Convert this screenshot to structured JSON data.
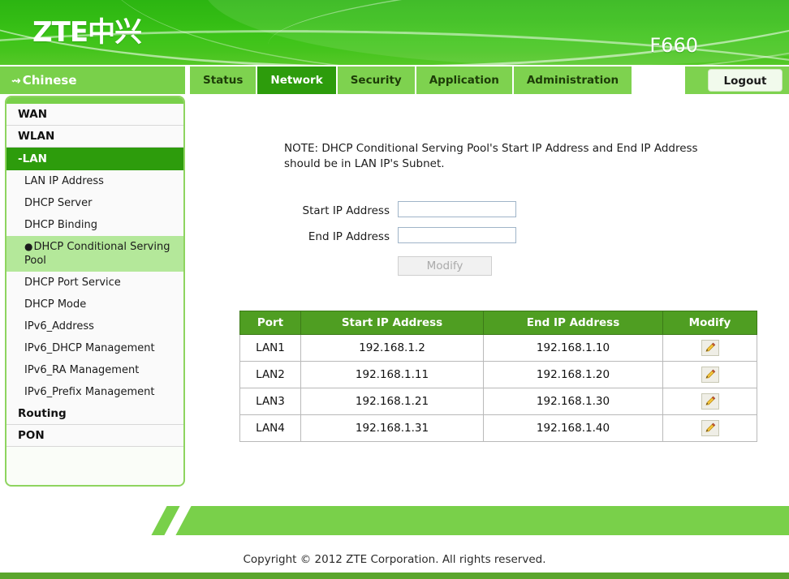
{
  "header": {
    "logo_text": "ZTE中兴",
    "model": "F660",
    "brand_green": "#3cc318"
  },
  "nav": {
    "language_button": {
      "label": "Chinese",
      "icon": "arrow-right-icon"
    },
    "tabs": [
      {
        "label": "Status",
        "active": false
      },
      {
        "label": "Network",
        "active": true
      },
      {
        "label": "Security",
        "active": false
      },
      {
        "label": "Application",
        "active": false
      },
      {
        "label": "Administration",
        "active": false
      }
    ],
    "logout_label": "Logout",
    "active_tab_color": "#2d9c0c",
    "tab_color": "#7ed24f"
  },
  "sidebar": {
    "items": [
      {
        "label": "WAN",
        "type": "group",
        "state": "normal"
      },
      {
        "label": "WLAN",
        "type": "group",
        "state": "normal"
      },
      {
        "label": "-LAN",
        "type": "group",
        "state": "selected"
      },
      {
        "label": "LAN IP Address",
        "type": "item",
        "state": "normal"
      },
      {
        "label": "DHCP Server",
        "type": "item",
        "state": "normal"
      },
      {
        "label": "DHCP Binding",
        "type": "item",
        "state": "normal"
      },
      {
        "label": "DHCP Conditional Serving Pool",
        "type": "item",
        "state": "active",
        "bullet": "●"
      },
      {
        "label": "DHCP Port Service",
        "type": "item",
        "state": "normal"
      },
      {
        "label": "DHCP Mode",
        "type": "item",
        "state": "normal"
      },
      {
        "label": "IPv6_Address",
        "type": "item",
        "state": "normal"
      },
      {
        "label": "IPv6_DHCP Management",
        "type": "item",
        "state": "normal"
      },
      {
        "label": "IPv6_RA Management",
        "type": "item",
        "state": "normal"
      },
      {
        "label": "IPv6_Prefix Management",
        "type": "item",
        "state": "normal"
      },
      {
        "label": "Routing",
        "type": "group",
        "state": "normal"
      },
      {
        "label": "PON",
        "type": "group",
        "state": "normal"
      }
    ]
  },
  "main": {
    "note": "NOTE:  DHCP Conditional Serving Pool's Start IP Address and End IP Address should be in LAN IP's Subnet.",
    "fields": [
      {
        "label": "Start IP Address",
        "value": "",
        "placeholder": ""
      },
      {
        "label": "End IP Address",
        "value": "",
        "placeholder": ""
      }
    ],
    "modify_button": {
      "label": "Modify",
      "disabled": true
    },
    "table": {
      "columns": [
        "Port",
        "Start IP Address",
        "End IP Address",
        "Modify"
      ],
      "rows": [
        {
          "port": "LAN1",
          "start_ip": "192.168.1.2",
          "end_ip": "192.168.1.10",
          "modify_icon": "pencil-icon"
        },
        {
          "port": "LAN2",
          "start_ip": "192.168.1.11",
          "end_ip": "192.168.1.20",
          "modify_icon": "pencil-icon"
        },
        {
          "port": "LAN3",
          "start_ip": "192.168.1.21",
          "end_ip": "192.168.1.30",
          "modify_icon": "pencil-icon"
        },
        {
          "port": "LAN4",
          "start_ip": "192.168.1.31",
          "end_ip": "192.168.1.40",
          "modify_icon": "pencil-icon"
        }
      ],
      "header_color": "#4f9e22"
    }
  },
  "footer": {
    "copyright": "Copyright © 2012 ZTE Corporation. All rights reserved."
  }
}
